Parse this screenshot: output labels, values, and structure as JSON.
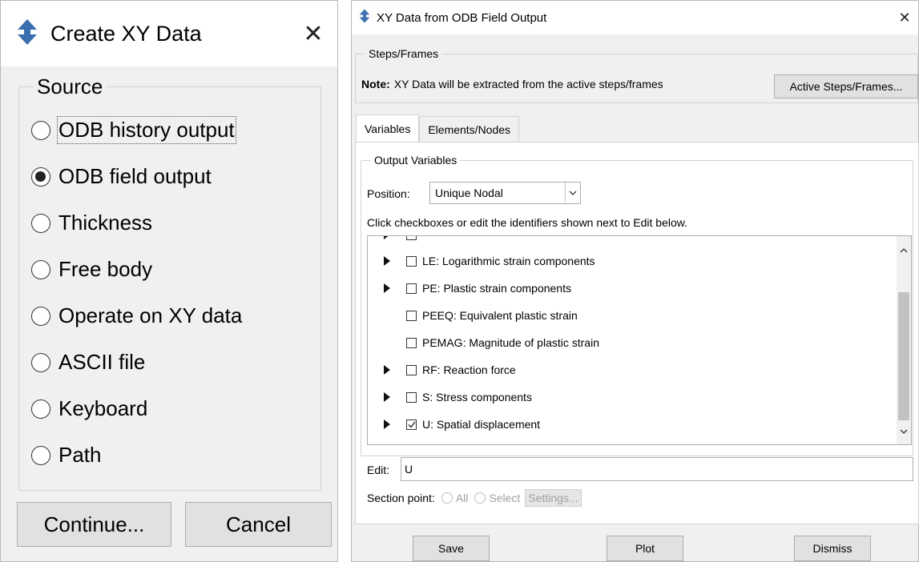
{
  "left_dialog": {
    "title": "Create XY Data",
    "close_glyph": "✕",
    "source_legend": "Source",
    "options": [
      {
        "label": "ODB history output",
        "selected": false
      },
      {
        "label": "ODB field output",
        "selected": true
      },
      {
        "label": "Thickness",
        "selected": false
      },
      {
        "label": "Free body",
        "selected": false
      },
      {
        "label": "Operate on XY data",
        "selected": false
      },
      {
        "label": "ASCII file",
        "selected": false
      },
      {
        "label": "Keyboard",
        "selected": false
      },
      {
        "label": "Path",
        "selected": false
      }
    ],
    "continue_label": "Continue...",
    "cancel_label": "Cancel"
  },
  "right_dialog": {
    "title": "XY Data from ODB Field Output",
    "close_glyph": "✕",
    "steps_legend": "Steps/Frames",
    "note_label": "Note:",
    "note_text": "XY Data will be extracted from the active steps/frames",
    "active_steps_button": "Active Steps/Frames...",
    "tabs": [
      {
        "label": "Variables",
        "active": true
      },
      {
        "label": "Elements/Nodes",
        "active": false
      }
    ],
    "output_legend": "Output Variables",
    "position_label": "Position:",
    "position_value": "Unique Nodal",
    "instructions": "Click checkboxes or edit the identifiers shown next to Edit below.",
    "variables": [
      {
        "label": "LE: Logarithmic strain components",
        "expandable": true,
        "checked": false
      },
      {
        "label": "PE: Plastic strain components",
        "expandable": true,
        "checked": false
      },
      {
        "label": "PEEQ: Equivalent plastic strain",
        "expandable": false,
        "checked": false
      },
      {
        "label": "PEMAG: Magnitude of plastic strain",
        "expandable": false,
        "checked": false
      },
      {
        "label": "RF: Reaction force",
        "expandable": true,
        "checked": false
      },
      {
        "label": "S: Stress components",
        "expandable": true,
        "checked": false
      },
      {
        "label": "U: Spatial displacement",
        "expandable": true,
        "checked": true
      }
    ],
    "edit_label": "Edit:",
    "edit_value": "U",
    "section_point_label": "Section point:",
    "section_all": "All",
    "section_select": "Select",
    "settings_button": "Settings...",
    "save_button": "Save",
    "plot_button": "Plot",
    "dismiss_button": "Dismiss"
  },
  "colors": {
    "icon_blue": "#3c6fb0",
    "window_bg": "#f0f0f0",
    "button_bg": "#e1e1e1"
  },
  "icons": {
    "app_icon": "abaqus-arrows-icon",
    "close_icon": "close-icon",
    "expand_icon": "triangle-right-icon",
    "dropdown_icon": "chevron-down-icon"
  }
}
